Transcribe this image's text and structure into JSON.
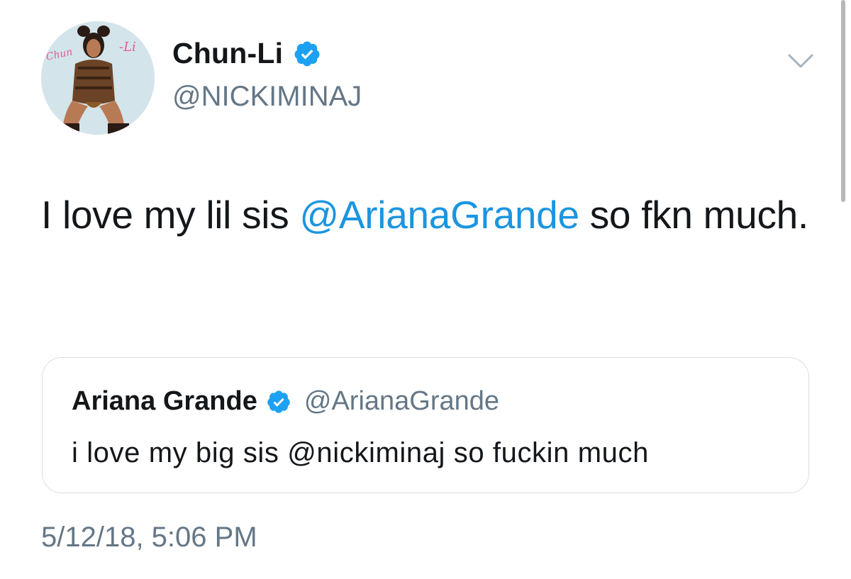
{
  "tweet": {
    "author": {
      "display_name": "Chun-Li",
      "handle": "@NICKIMINAJ",
      "verified": true,
      "avatar_text": "Chun-Li"
    },
    "text_parts": {
      "before": "I love my lil sis ",
      "mention": "@ArianaGrande",
      "after": " so fkn much."
    },
    "quoted": {
      "display_name": "Ariana Grande",
      "handle": "@ArianaGrande",
      "verified": true,
      "text": "i love my big sis @nickiminaj so fuckin much"
    },
    "timestamp": "5/12/18, 5:06 PM"
  },
  "colors": {
    "link": "#1b95e0",
    "secondary_text": "#657786",
    "verified_badge": "#1da1f2",
    "card_border": "#d8dee2"
  },
  "icons": {
    "verified": "verified-badge-icon",
    "menu": "chevron-down-icon"
  }
}
